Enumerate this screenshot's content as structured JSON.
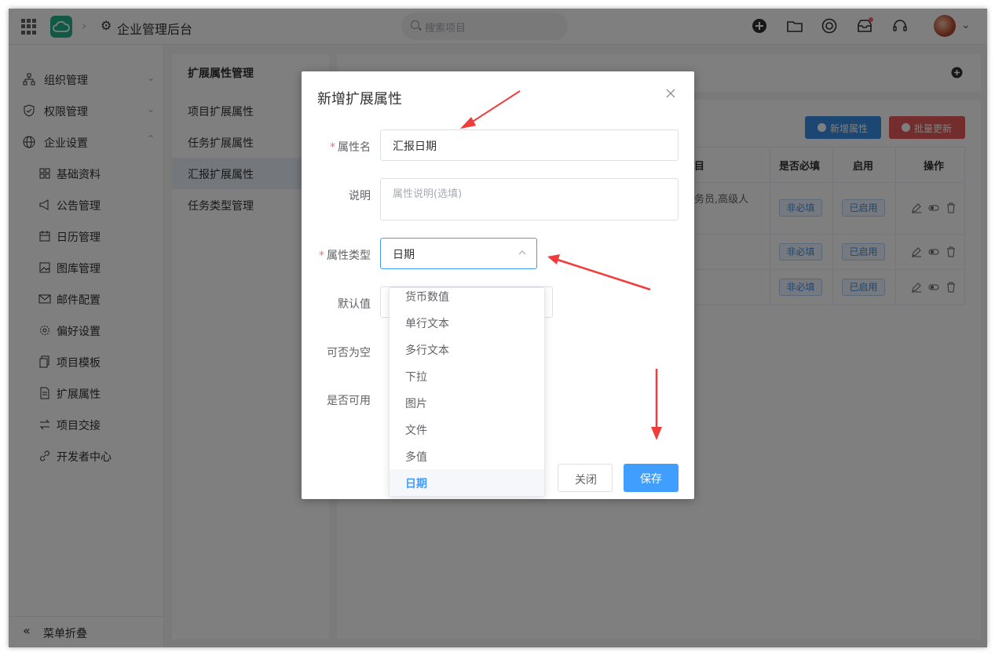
{
  "header": {
    "app_title": "企业管理后台",
    "search_placeholder": "搜索项目"
  },
  "sidebar": {
    "items": [
      {
        "label": "组织管理"
      },
      {
        "label": "权限管理"
      },
      {
        "label": "企业设置"
      },
      {
        "label": "基础资料"
      },
      {
        "label": "公告管理"
      },
      {
        "label": "日历管理"
      },
      {
        "label": "图库管理"
      },
      {
        "label": "邮件配置"
      },
      {
        "label": "偏好设置"
      },
      {
        "label": "项目模板"
      },
      {
        "label": "扩展属性"
      },
      {
        "label": "项目交接"
      },
      {
        "label": "开发者中心"
      }
    ],
    "collapse_label": "菜单折叠"
  },
  "panel2": {
    "title": "扩展属性管理",
    "items": [
      {
        "label": "项目扩展属性"
      },
      {
        "label": "任务扩展属性"
      },
      {
        "label": "汇报扩展属性"
      },
      {
        "label": "任务类型管理"
      }
    ]
  },
  "main": {
    "add_button": "新增属性",
    "batch_button": "批量更新",
    "columns": [
      "目",
      "是否必填",
      "启用",
      "操作"
    ],
    "row1_text": "务员,高级人",
    "rows": [
      {
        "required": "非必填",
        "enabled": "已启用"
      },
      {
        "required": "非必填",
        "enabled": "已启用"
      },
      {
        "required": "非必填",
        "enabled": "已启用"
      }
    ]
  },
  "dialog": {
    "title": "新增扩展属性",
    "fields": {
      "name_label": "属性名",
      "name_value": "汇报日期",
      "desc_label": "说明",
      "desc_placeholder": "属性说明(选填)",
      "type_label": "属性类型",
      "type_value": "日期",
      "default_label": "默认值",
      "nullable_label": "可否为空",
      "enabled_label": "是否可用"
    },
    "close_button": "关闭",
    "save_button": "保存"
  },
  "dropdown": {
    "options": [
      "货币数值",
      "单行文本",
      "多行文本",
      "下拉",
      "图片",
      "文件",
      "多值",
      "日期"
    ],
    "selected": "日期"
  },
  "colors": {
    "primary": "#409eff",
    "danger": "#e85b5b",
    "annotation_arrow": "#f23c3c"
  }
}
